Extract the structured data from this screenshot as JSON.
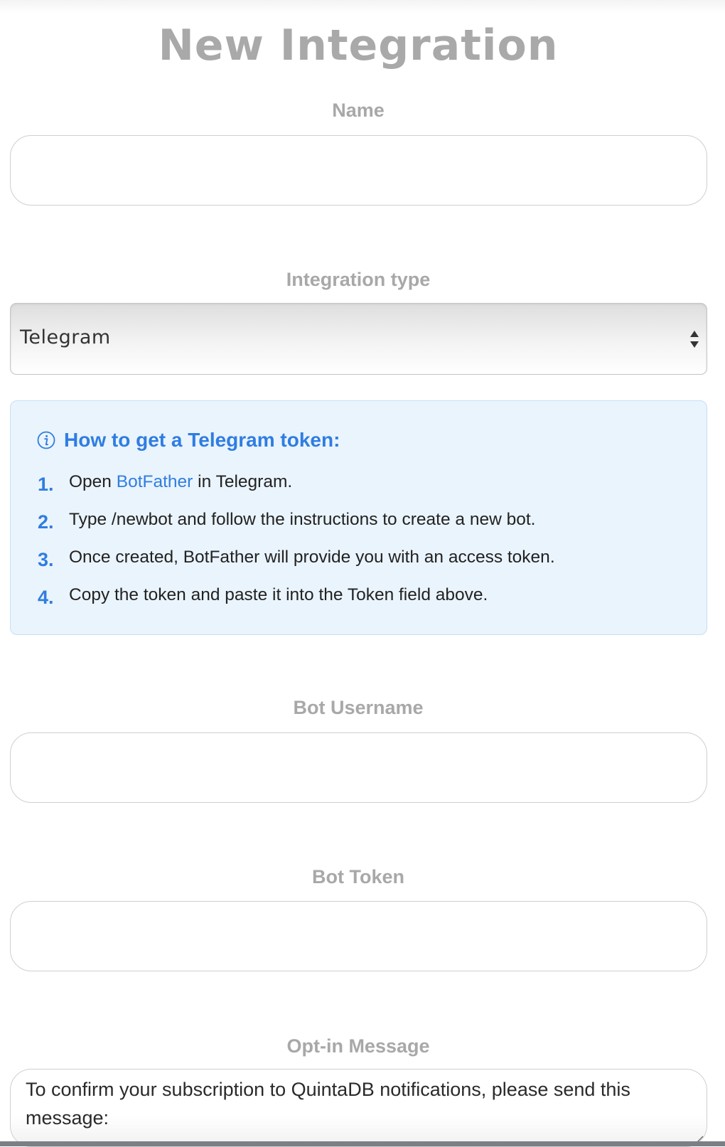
{
  "page": {
    "title": "New Integration"
  },
  "fields": {
    "name": {
      "label": "Name",
      "value": "",
      "placeholder": ""
    },
    "integration_type": {
      "label": "Integration type",
      "selected": "Telegram"
    },
    "bot_username": {
      "label": "Bot Username",
      "value": "",
      "placeholder": ""
    },
    "bot_token": {
      "label": "Bot Token",
      "value": "",
      "placeholder": ""
    },
    "opt_in_message": {
      "label": "Opt-in Message",
      "value": "To confirm your subscription to QuintaDB notifications, please send this message:"
    }
  },
  "info": {
    "icon": "info-circle-icon",
    "title": "How to get a Telegram token:",
    "steps": [
      {
        "number": "1.",
        "text_before": "Open ",
        "link": "BotFather",
        "text_after": " in Telegram."
      },
      {
        "number": "2.",
        "text": "Type /newbot and follow the instructions to create a new bot."
      },
      {
        "number": "3.",
        "text": "Once created, BotFather will provide you with an access token."
      },
      {
        "number": "4.",
        "text": "Copy the token and paste it into the Token field above."
      }
    ]
  },
  "colors": {
    "accent": "#2f7de1",
    "label_gray": "#a8a8a8",
    "info_background": "#eaf4fd",
    "info_border": "#c7def6"
  }
}
